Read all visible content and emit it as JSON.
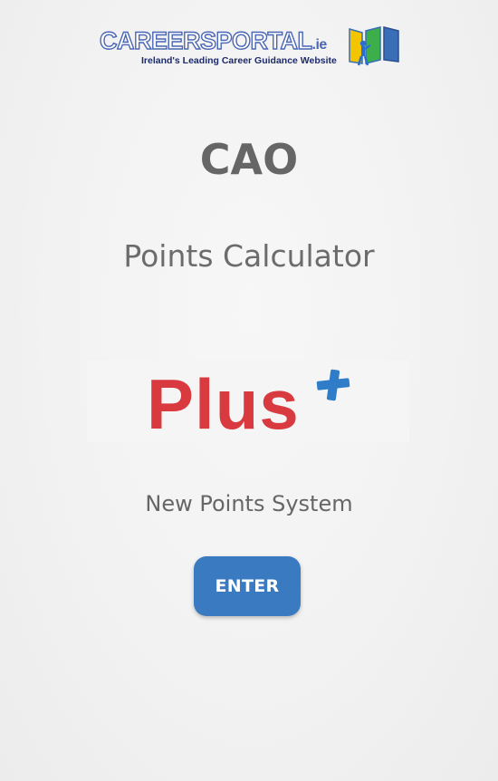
{
  "header": {
    "logo_main": "CAREERSPORTAL",
    "logo_suffix": ".ie",
    "logo_tagline": "Ireland's Leading Career Guidance Website",
    "logo_icon": "doors-person-icon"
  },
  "main": {
    "title": "CAO",
    "subtitle": "Points Calculator",
    "plus_logo": "Plus",
    "plus_icon": "plus-superscript-icon",
    "tagline": "New Points System",
    "enter_label": "ENTER"
  },
  "colors": {
    "accent_blue": "#3a7ac0",
    "plus_red": "#d93a3f",
    "plus_blue": "#2f7cc8",
    "text_gray": "#666666",
    "logo_blue": "#4a67b5"
  }
}
